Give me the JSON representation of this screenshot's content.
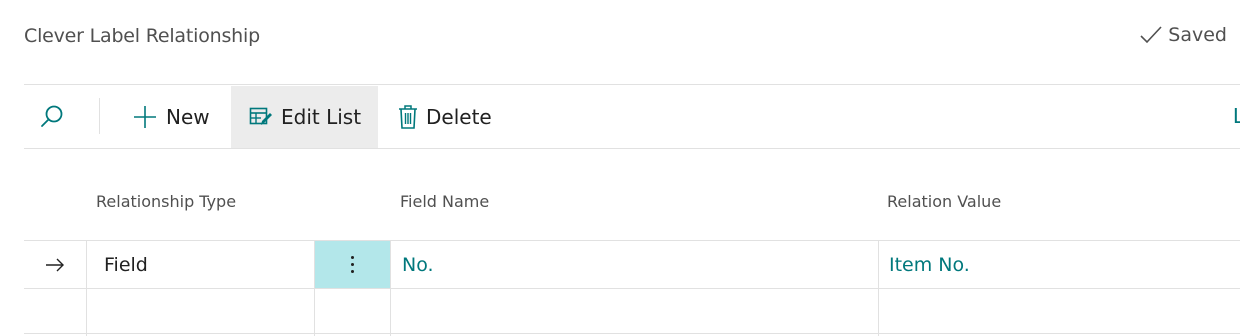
{
  "header": {
    "title": "Clever Label Relationship",
    "status": "Saved"
  },
  "toolbar": {
    "new_label": "New",
    "edit_list_label": "Edit List",
    "delete_label": "Delete",
    "overflow_glyph": "L"
  },
  "table": {
    "columns": [
      "Relationship Type",
      "Field Name",
      "Relation Value"
    ],
    "rows": [
      {
        "relationship_type": "Field",
        "field_name": "No.",
        "relation_value": "Item No."
      },
      {
        "relationship_type": "",
        "field_name": "",
        "relation_value": ""
      }
    ]
  },
  "colors": {
    "accent": "#00787c",
    "selected_cell": "#b3e7ea",
    "border": "#e1e1e1"
  },
  "icons": [
    "search-icon",
    "plus-icon",
    "edit-list-icon",
    "trash-icon",
    "checkmark-icon",
    "arrow-right-icon",
    "more-options-icon"
  ]
}
